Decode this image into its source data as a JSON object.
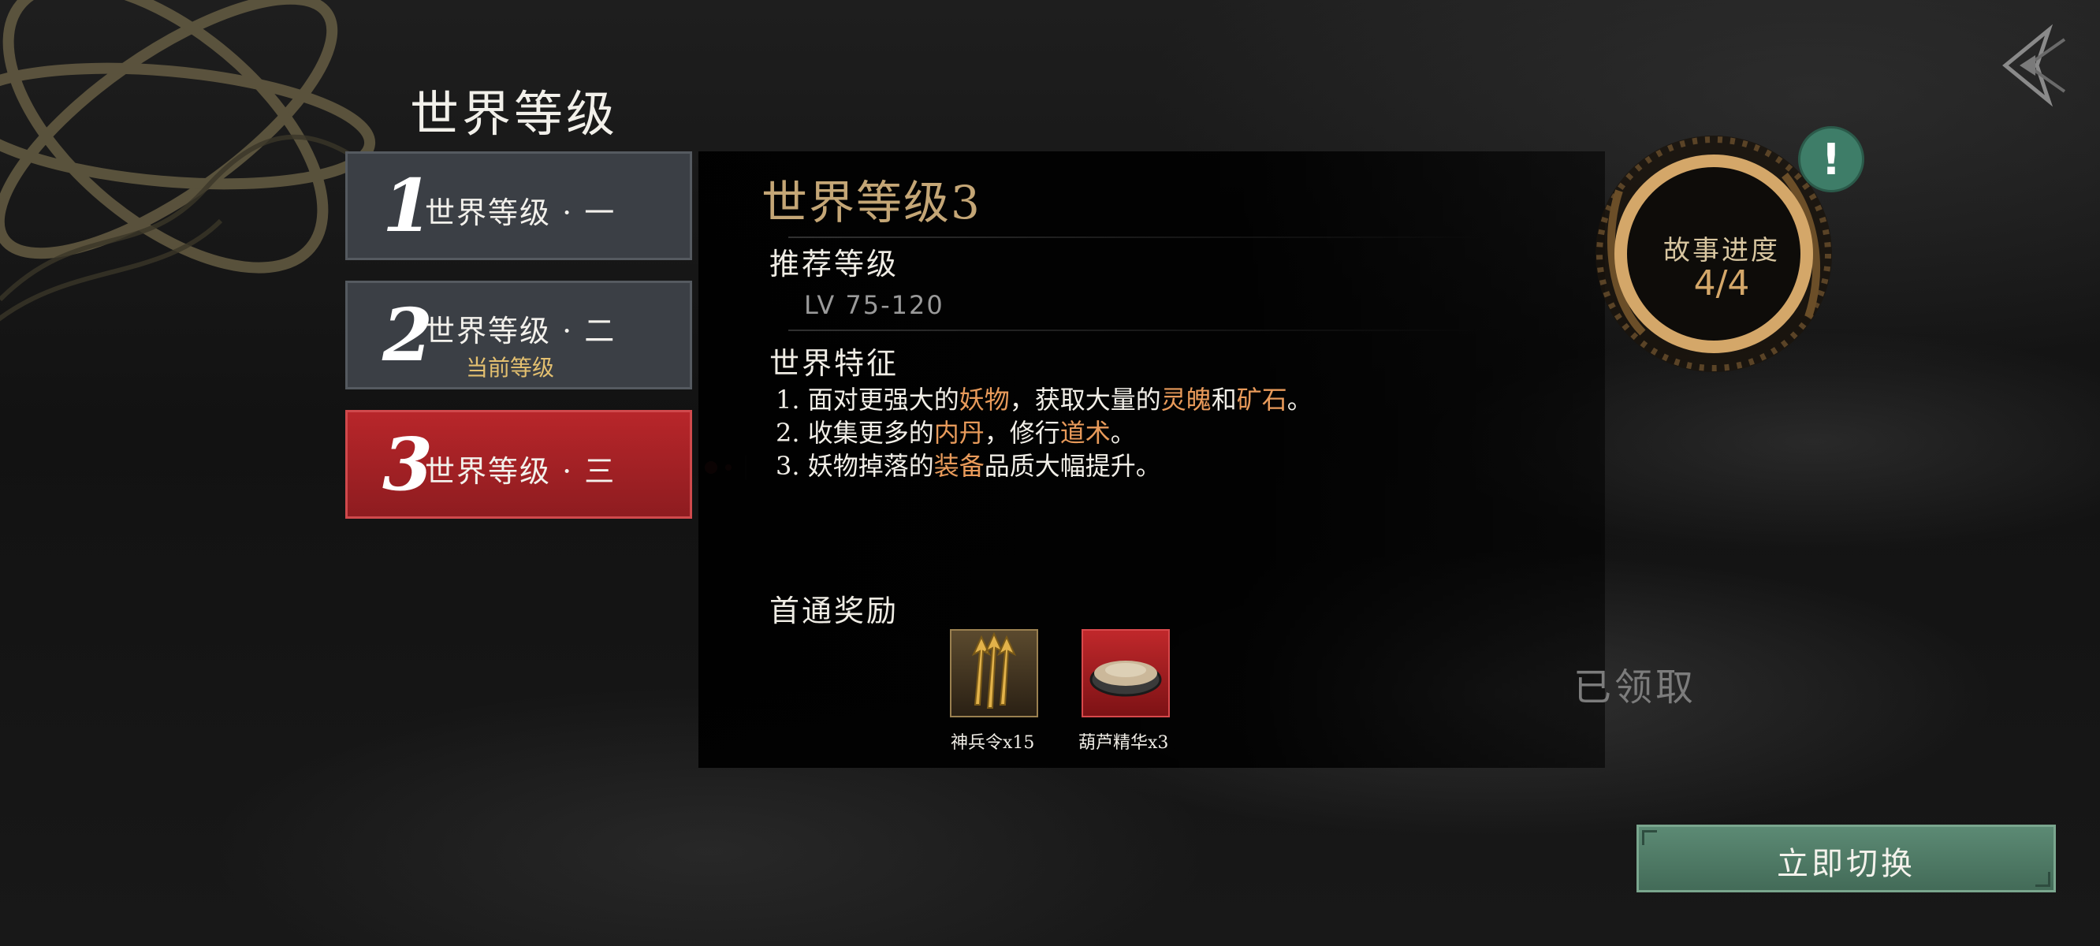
{
  "page": {
    "title": "世界等级"
  },
  "levels": [
    {
      "num": "1",
      "label": "世界等级 · 一",
      "sub": ""
    },
    {
      "num": "2",
      "label": "世界等级 · 二",
      "sub": "当前等级"
    },
    {
      "num": "3",
      "label": "世界等级 · 三",
      "sub": ""
    }
  ],
  "selected_level": 3,
  "detail": {
    "title": "世界等级3",
    "recommended_heading": "推荐等级",
    "level_range": "LV 75-120",
    "features_heading": "世界特征",
    "features": [
      {
        "prefix": "1. 面对更强大的",
        "hl1": "妖物",
        "mid1": "，获取大量的",
        "hl2": "灵魄",
        "mid2": "和",
        "hl3": "矿石",
        "suffix": "。"
      },
      {
        "prefix": "2. 收集更多的",
        "hl1": "内丹",
        "mid1": "，修行",
        "hl2": "道术",
        "suffix": "。"
      },
      {
        "prefix": "3. 妖物掉落的",
        "hl1": "装备",
        "suffix": "品质大幅提升。"
      }
    ],
    "rewards_heading": "首通奖励",
    "rewards": [
      {
        "name": "神兵令x15",
        "icon": "arrows-token-icon"
      },
      {
        "name": "葫芦精华x3",
        "icon": "essence-bowl-icon"
      }
    ],
    "claimed_label": "已领取"
  },
  "story_progress": {
    "label": "故事进度",
    "value": "4/4",
    "progress": 1.0
  },
  "alert_badge": "!",
  "switch_button": "立即切换",
  "colors": {
    "highlight": "#e89a5a",
    "selected_red": "#b8262a",
    "current_gold": "#e4c070",
    "switch_green": "#5c8a74",
    "ring_gold": "#d4a769"
  }
}
